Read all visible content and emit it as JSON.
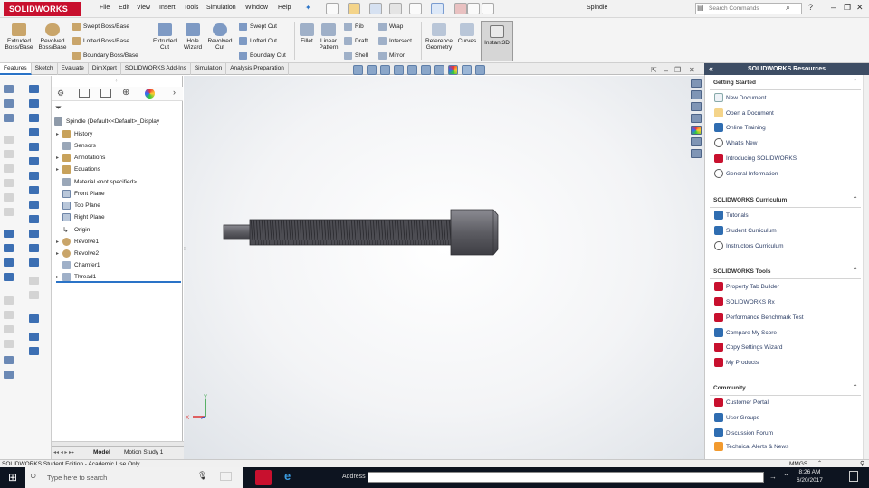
{
  "app": {
    "logo_text": "SOLIDWORKS",
    "doc_title": "Spindle"
  },
  "menu": [
    "File",
    "Edit",
    "View",
    "Insert",
    "Tools",
    "Simulation",
    "Window",
    "Help"
  ],
  "search": {
    "placeholder": "Search Commands"
  },
  "ribbon": {
    "extruded_boss": "Extruded Boss/Base",
    "revolved_boss": "Revolved Boss/Base",
    "swept_boss": "Swept Boss/Base",
    "lofted_boss": "Lofted Boss/Base",
    "boundary_boss": "Boundary Boss/Base",
    "extruded_cut": "Extruded Cut",
    "hole_wizard": "Hole Wizard",
    "revolved_cut": "Revolved Cut",
    "swept_cut": "Swept Cut",
    "lofted_cut": "Lofted Cut",
    "boundary_cut": "Boundary Cut",
    "fillet": "Fillet",
    "linear_pattern": "Linear Pattern",
    "rib": "Rib",
    "draft": "Draft",
    "shell": "Shell",
    "wrap": "Wrap",
    "intersect": "Intersect",
    "mirror": "Mirror",
    "reference_geometry": "Reference Geometry",
    "curves": "Curves",
    "instant3d": "Instant3D"
  },
  "command_tabs": [
    "Features",
    "Sketch",
    "Evaluate",
    "DimXpert",
    "SOLIDWORKS Add-Ins",
    "Simulation",
    "Analysis Preparation"
  ],
  "tree": {
    "root": "Spindle  (Default<<Default>_Display",
    "items": [
      "History",
      "Sensors",
      "Annotations",
      "Equations",
      "Material <not specified>",
      "Front Plane",
      "Top Plane",
      "Right Plane",
      "Origin",
      "Revolve1",
      "Revolve2",
      "Chamfer1",
      "Thread1"
    ]
  },
  "bottom_tabs": [
    "Model",
    "Motion Study 1"
  ],
  "resources": {
    "title": "SOLIDWORKS Resources",
    "sections": [
      {
        "title": "Getting Started",
        "items": [
          "New Document",
          "Open a Document",
          "Online Training",
          "What's New",
          "Introducing SOLIDWORKS",
          "General Information"
        ]
      },
      {
        "title": "SOLIDWORKS Curriculum",
        "items": [
          "Tutorials",
          "Student Curriculum",
          "Instructors Curriculum"
        ]
      },
      {
        "title": "SOLIDWORKS Tools",
        "items": [
          "Property Tab Builder",
          "SOLIDWORKS Rx",
          "Performance Benchmark Test",
          "Compare My Score",
          "Copy Settings Wizard",
          "My Products"
        ]
      },
      {
        "title": "Community",
        "items": [
          "Customer Portal",
          "User Groups",
          "Discussion Forum",
          "Technical Alerts & News"
        ]
      }
    ]
  },
  "status": {
    "text": "SOLIDWORKS Student Edition - Academic Use Only",
    "units": "MMGS"
  },
  "taskbar": {
    "search_placeholder": "Type here to search",
    "address_label": "Address",
    "time": "8:26 AM",
    "date": "6/20/2017"
  },
  "colors": {
    "brand": "#c8102e",
    "part": "#5d5d63",
    "accent": "#2a73c7"
  }
}
